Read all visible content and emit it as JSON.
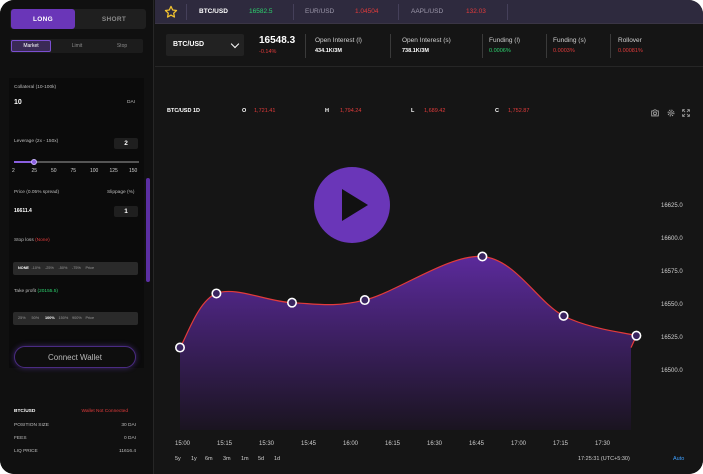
{
  "colors": {
    "accent": "#6a36b8",
    "positive": "#2dd36f",
    "negative": "#e23b3b",
    "link": "#3ea0ff"
  },
  "sidebar": {
    "side_tabs": [
      "LONG",
      "SHORT"
    ],
    "order_tabs": [
      "Market",
      "Limit",
      "Stop"
    ],
    "collateral_label": "Collateral (10-100k)",
    "collateral_value": "10",
    "collateral_unit": "DAI",
    "leverage_label": "Leverage (2x - 150x)",
    "leverage_value": "2",
    "leverage_ticks": [
      "2",
      "25",
      "50",
      "75",
      "100",
      "125",
      "150"
    ],
    "price_label": "Price (0.05% spread)",
    "slippage_label": "Slippage (%)",
    "price_value": "16611.4",
    "slippage_value": "1",
    "stop_loss_label": "Stop loss",
    "stop_loss_value": "(None)",
    "stop_loss_options": [
      "NONE",
      "-10%",
      "-25%",
      "-50%",
      "-75%",
      "Price"
    ],
    "take_profit_label": "Take profit",
    "take_profit_value": "(20155.5)",
    "take_profit_options": [
      "25%",
      "50%",
      "100%",
      "150%",
      "900%",
      "Price"
    ],
    "connect_label": "Connect Wallet",
    "summary_pair": "BTC/USD",
    "summary_status": "Wallet Not Connected",
    "position_size_label": "POSITION SIZE",
    "position_size_value": "30 DAI",
    "fees_label": "FEES",
    "fees_value": "0 DAI",
    "liq_label": "LIQ PRICE",
    "liq_value": "11616.4"
  },
  "topbar": {
    "pairs": [
      {
        "name": "BTC/USD",
        "value": "16582.5",
        "color": "#2dd36f"
      },
      {
        "name": "EUR/USD",
        "value": "1.04504",
        "color": "#e23b3b"
      },
      {
        "name": "AAPL/USD",
        "value": "132.03",
        "color": "#e23b3b"
      }
    ]
  },
  "header": {
    "selected_pair": "BTC/USD",
    "price": "16548.3",
    "change": "-0.14%",
    "stats": [
      {
        "title": "Open Interest (l)",
        "value": "434.1K/3M",
        "tone": "white"
      },
      {
        "title": "Open Interest (s)",
        "value": "738.1K/3M",
        "tone": "white"
      },
      {
        "title": "Funding (l)",
        "value": "0.0006%",
        "tone": "green"
      },
      {
        "title": "Funding (s)",
        "value": "0.0003%",
        "tone": "red"
      },
      {
        "title": "Rollover",
        "value": "0.00081%",
        "tone": "red"
      }
    ]
  },
  "chart_data": {
    "type": "area",
    "symbol_label": "BTC/USD 1D",
    "ohlc": [
      {
        "label": "O",
        "value": "1,721.41"
      },
      {
        "label": "H",
        "value": "1,794.24"
      },
      {
        "label": "L",
        "value": "1,689.42"
      },
      {
        "label": "C",
        "value": "1,752.87"
      }
    ],
    "x": [
      "15:00",
      "15:15",
      "15:30",
      "15:45",
      "16:00",
      "16:15",
      "16:30",
      "16:45",
      "17:00",
      "17:15",
      "17:30"
    ],
    "y_ticks": [
      "16625.0",
      "16600.0",
      "16575.0",
      "16550.0",
      "16525.0",
      "16500.0"
    ],
    "ylim": [
      16500,
      16625
    ],
    "points": [
      {
        "x": "15:00",
        "y": 16517
      },
      {
        "x": "15:13",
        "y": 16558
      },
      {
        "x": "15:40",
        "y": 16551
      },
      {
        "x": "16:06",
        "y": 16553
      },
      {
        "x": "16:48",
        "y": 16586
      },
      {
        "x": "17:17",
        "y": 16541
      },
      {
        "x": "17:43",
        "y": 16526
      }
    ],
    "line_color": "#e23b3b",
    "fill_color": "#5b2a9b",
    "range_buttons": [
      "5y",
      "1y",
      "6m",
      "3m",
      "1m",
      "5d",
      "1d"
    ],
    "clock": "17:25:31 (UTC+5:30)",
    "auto_label": "Auto"
  }
}
